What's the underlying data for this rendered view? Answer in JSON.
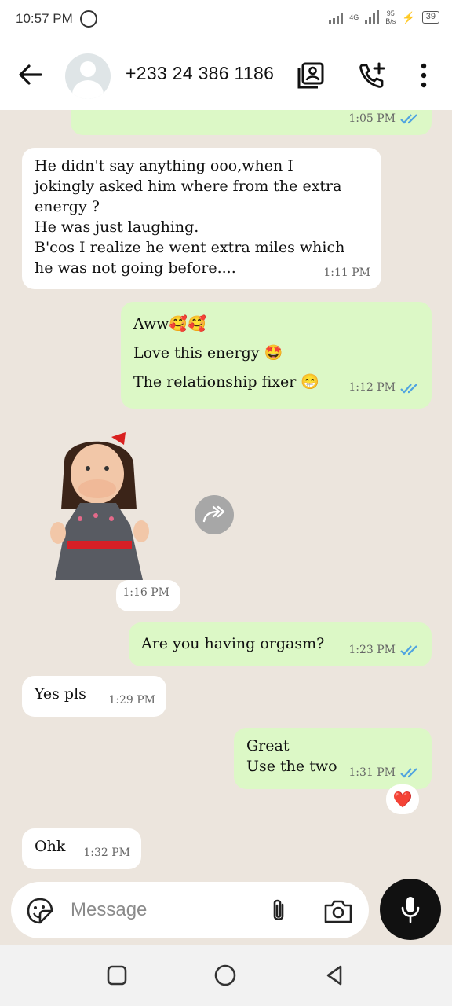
{
  "status_bar": {
    "time": "10:57 PM",
    "network": "4G",
    "speed_value": "95",
    "speed_unit": "B/s",
    "battery": "39"
  },
  "header": {
    "contact": "+233 24 386 1186"
  },
  "messages": [
    {
      "dir": "out",
      "lines": [],
      "time": "1:05 PM"
    },
    {
      "dir": "in",
      "lines": [
        "He didn't say anything ooo,when I",
        "jokingly asked him where from the extra",
        "energy ?",
        "He was just laughing.",
        "B'cos I realize he went extra miles which",
        "he was not going before...."
      ],
      "time": "1:11 PM"
    },
    {
      "dir": "out",
      "lines": [
        "Aww🥰🥰",
        "Love this energy 🤩",
        "The relationship fixer 😁"
      ],
      "time": "1:12 PM"
    },
    {
      "dir": "in",
      "type": "sticker",
      "time": "1:16 PM"
    },
    {
      "dir": "out",
      "lines": [
        "Are you having orgasm?"
      ],
      "time": "1:23 PM"
    },
    {
      "dir": "in",
      "lines": [
        "Yes pls"
      ],
      "time": "1:29 PM"
    },
    {
      "dir": "out",
      "lines": [
        "Great",
        "Use the two"
      ],
      "time": "1:31 PM",
      "reaction": "❤️"
    },
    {
      "dir": "in",
      "lines": [
        "Ohk"
      ],
      "time": "1:32 PM"
    }
  ],
  "composer": {
    "placeholder": "Message"
  },
  "colors": {
    "outgoing": "#dcf8c6",
    "incoming": "#ffffff",
    "background": "#ece5dd",
    "tick": "#4fa3e0"
  }
}
